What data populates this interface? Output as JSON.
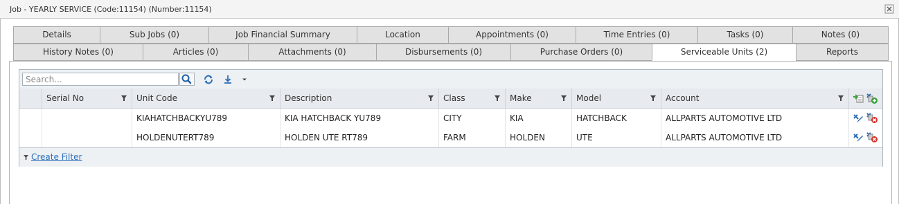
{
  "window": {
    "title": "Job - YEARLY SERVICE (Code:11154) (Number:11154)",
    "close_icon": "close-icon"
  },
  "tabs_row1": [
    "Details",
    "Sub Jobs (0)",
    "Job Financial Summary",
    "Location",
    "Appointments (0)",
    "Time Entries (0)",
    "Tasks (0)",
    "Notes (0)"
  ],
  "tabs_row2": [
    "History Notes (0)",
    "Articles (0)",
    "Attachments (0)",
    "Disbursements (0)",
    "Purchase Orders (0)",
    "Serviceable Units (2)",
    "Reports"
  ],
  "active_tab": "Serviceable Units (2)",
  "grid": {
    "search_placeholder": "Search...",
    "toolbar_icons": [
      "search-icon",
      "refresh-icon",
      "export-icon",
      "dropdown-arrow-icon"
    ],
    "columns": [
      "",
      "Serial No",
      "Unit Code",
      "Description",
      "Class",
      "Make",
      "Model",
      "Account"
    ],
    "rows": [
      [
        "",
        "",
        "KIAHATCHBACKYU789",
        "KIA HATCHBACK YU789",
        "CITY",
        "KIA",
        "HATCHBACK",
        "ALLPARTS AUTOMOTIVE LTD"
      ],
      [
        "",
        "",
        "HOLDENUTERT789",
        "HOLDEN UTE RT789",
        "FARM",
        "HOLDEN",
        "UTE",
        "ALLPARTS AUTOMOTIVE LTD"
      ]
    ],
    "header_action_icons": [
      "import-icon",
      "add-unit-icon"
    ],
    "row_action_icons": [
      "edit-icon",
      "delete-icon"
    ],
    "footer": {
      "create_filter": "Create Filter"
    }
  },
  "colors": {
    "tab_bg": "#e2e2e2",
    "active_tab_bg": "#ffffff",
    "toolbar_bg": "#eef1f4",
    "header_bg": "#e7eaee",
    "link": "#2a6fb8",
    "delete_red": "#d9322b",
    "add_green": "#39a33a"
  }
}
